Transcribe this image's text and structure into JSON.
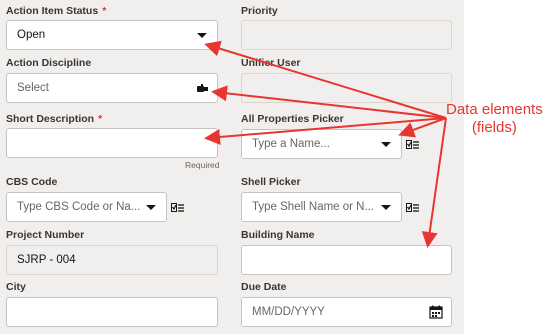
{
  "fields": {
    "action_item_status": {
      "label": "Action Item Status",
      "required_mark": "*",
      "value": "Open"
    },
    "priority": {
      "label": "Priority",
      "value": ""
    },
    "action_discipline": {
      "label": "Action Discipline",
      "value": "Select"
    },
    "unifier_user": {
      "label": "Unifier User",
      "value": ""
    },
    "short_description": {
      "label": "Short Description",
      "required_mark": "*",
      "value": "",
      "helper": "Required"
    },
    "all_properties_picker": {
      "label": "All Properties Picker",
      "placeholder": "Type a Name..."
    },
    "cbs_code": {
      "label": "CBS Code",
      "placeholder": "Type CBS Code or Na..."
    },
    "shell_picker": {
      "label": "Shell Picker",
      "placeholder": "Type Shell Name or N..."
    },
    "project_number": {
      "label": "Project Number",
      "value": "SJRP - 004"
    },
    "building_name": {
      "label": "Building Name",
      "value": ""
    },
    "city": {
      "label": "City",
      "value": ""
    },
    "due_date": {
      "label": "Due Date",
      "placeholder": "MM/DD/YYYY"
    }
  },
  "annotation": {
    "line1": "Data elements",
    "line2": "(fields)"
  },
  "icons": {
    "dropdown": "chevron-down-icon",
    "picker": "multi-select-picker-icon",
    "discipline": "hand-pointer-icon",
    "calendar": "calendar-icon"
  },
  "colors": {
    "annotation": "#e8352f",
    "required": "#d63b25",
    "panel": "#f1efed"
  }
}
